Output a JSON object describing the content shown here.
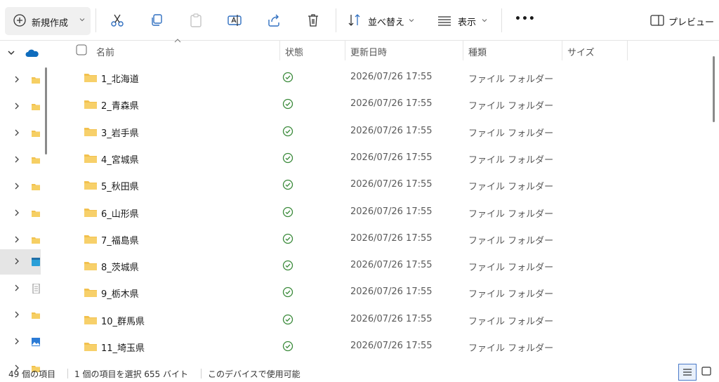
{
  "toolbar": {
    "new_label": "新規作成",
    "sort_label": "並べ替え",
    "view_label": "表示",
    "more_label": "•••",
    "preview_label": "プレビュー"
  },
  "columns": {
    "name": "名前",
    "status": "状態",
    "modified": "更新日時",
    "type": "種類",
    "size": "サイズ"
  },
  "files": [
    {
      "name": "1_北海道",
      "date": "2026/07/26 17:55",
      "type": "ファイル フォルダー"
    },
    {
      "name": "2_青森県",
      "date": "2026/07/26 17:55",
      "type": "ファイル フォルダー"
    },
    {
      "name": "3_岩手県",
      "date": "2026/07/26 17:55",
      "type": "ファイル フォルダー"
    },
    {
      "name": "4_宮城県",
      "date": "2026/07/26 17:55",
      "type": "ファイル フォルダー"
    },
    {
      "name": "5_秋田県",
      "date": "2026/07/26 17:55",
      "type": "ファイル フォルダー"
    },
    {
      "name": "6_山形県",
      "date": "2026/07/26 17:55",
      "type": "ファイル フォルダー"
    },
    {
      "name": "7_福島県",
      "date": "2026/07/26 17:55",
      "type": "ファイル フォルダー"
    },
    {
      "name": "8_茨城県",
      "date": "2026/07/26 17:55",
      "type": "ファイル フォルダー"
    },
    {
      "name": "9_栃木県",
      "date": "2026/07/26 17:55",
      "type": "ファイル フォルダー"
    },
    {
      "name": "10_群馬県",
      "date": "2026/07/26 17:55",
      "type": "ファイル フォルダー"
    },
    {
      "name": "11_埼玉県",
      "date": "2026/07/26 17:55",
      "type": "ファイル フォルダー"
    }
  ],
  "statusbar": {
    "count": "49 個の項目",
    "selection": "1 個の項目を選択  655 バイト",
    "availability": "このデバイスで使用可能"
  },
  "colors": {
    "folder": "#f2c14e",
    "status_green": "#3a8a3a",
    "accent": "#0067c0"
  }
}
